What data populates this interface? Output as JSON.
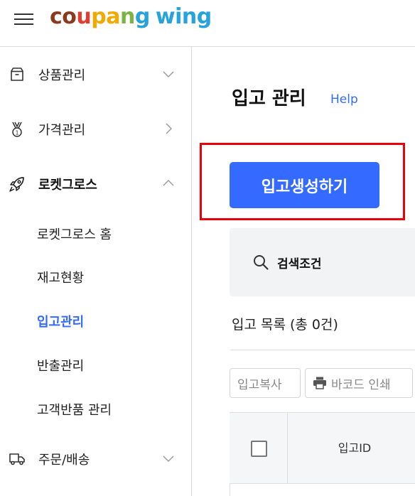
{
  "header": {
    "logo_parts": [
      "c",
      "o",
      "u",
      "p",
      "a",
      "n",
      "g"
    ],
    "logo_wing": "wing",
    "logo_colors": [
      "#8b3a1e",
      "#e03c31",
      "#f2a900",
      "#7cb342",
      "#26a3dd"
    ]
  },
  "sidebar": {
    "items": [
      {
        "label": "상품관리",
        "icon": "box-icon",
        "chevron": "down"
      },
      {
        "label": "가격관리",
        "icon": "medal-icon",
        "chevron": "right"
      },
      {
        "label": "로켓그로스",
        "icon": "rocket-icon",
        "chevron": "up"
      },
      {
        "label": "주문/배송",
        "icon": "truck-icon",
        "chevron": "down"
      }
    ],
    "sub_items": [
      {
        "label": "로켓그로스 홈",
        "active": false
      },
      {
        "label": "재고현황",
        "active": false
      },
      {
        "label": "입고관리",
        "active": true
      },
      {
        "label": "반출관리",
        "active": false
      },
      {
        "label": "고객반품 관리",
        "active": false
      }
    ]
  },
  "main": {
    "title": "입고 관리",
    "help": "Help",
    "create_button": "입고생성하기",
    "search_label": "검색조건",
    "list_title": "입고 목록 (총 0건)",
    "copy_button": "입고복사",
    "barcode_button": "바코드 인쇄",
    "table": {
      "columns": [
        "",
        "입고ID"
      ]
    }
  },
  "colors": {
    "accent": "#346aff",
    "highlight": "#e8000b"
  }
}
